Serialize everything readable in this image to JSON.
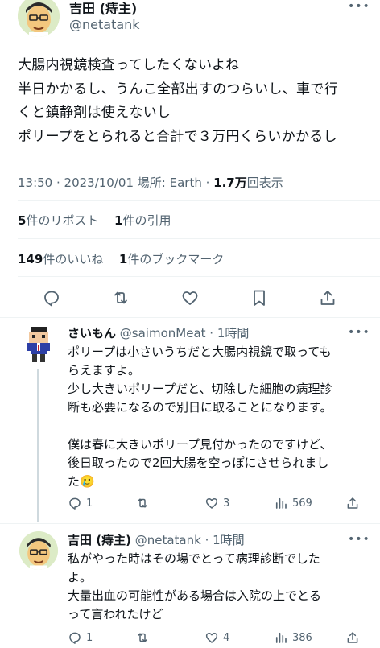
{
  "main_tweet": {
    "author_name": "吉田 (痔主)",
    "author_handle": "@netatank",
    "text_lines": [
      "大腸内視鏡検査ってしたくないよね",
      "半日かかるし、うんこ全部出すのつらいし、車で行",
      "くと鎮静剤は使えないし",
      "ポリープをとられると合計で３万円くらいかかるし"
    ],
    "meta": {
      "datetime": "13:50 · 2023/10/01",
      "location_label": "場所: Earth",
      "views_count": "1.7万",
      "views_label": "回表示"
    },
    "stats": {
      "reposts_count": "5",
      "reposts_label": "件のリポスト",
      "quotes_count": "1",
      "quotes_label": "件の引用",
      "likes_count": "149",
      "likes_label": "件のいいね",
      "bookmarks_count": "1",
      "bookmarks_label": "件のブックマーク"
    }
  },
  "replies": [
    {
      "author_name": "さいもん",
      "author_handle": "@saimonMeat",
      "time": "· 1時間",
      "text_lines": [
        "ポリープは小さいうちだと大腸内視鏡で取っても",
        "らえますよ。",
        "少し大きいポリープだと、切除した細胞の病理診",
        "断も必要になるので別日に取ることになります。",
        "",
        "僕は春に大きいポリープ見付かったのですけど、",
        "後日取ったので2回大腸を空っぽにさせられまし",
        "た🥲"
      ],
      "replies_count": "1",
      "reposts_count": "",
      "likes_count": "3",
      "views_count": "569"
    },
    {
      "author_name": "吉田 (痔主)",
      "author_handle": "@netatank",
      "time": "· 1時間",
      "text_lines": [
        "私がやった時はその場でとって病理診断でした",
        "よ。",
        "大量出血の可能性がある場合は入院の上でとる",
        "って言われたけど"
      ],
      "replies_count": "1",
      "reposts_count": "",
      "likes_count": "4",
      "views_count": "386"
    }
  ],
  "colors": {
    "text": "#0f1419",
    "muted": "#536471",
    "divider": "#eff3f4",
    "thread_line": "#cfd9de"
  }
}
